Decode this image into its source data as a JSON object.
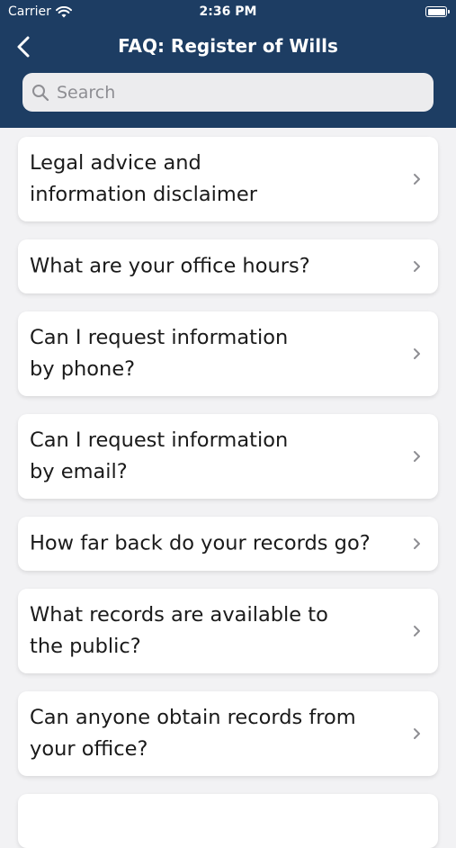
{
  "status_bar": {
    "carrier": "Carrier",
    "time": "2:36 PM"
  },
  "nav": {
    "title": "FAQ: Register of Wills",
    "back_icon": "chevron-left-icon"
  },
  "search": {
    "placeholder": "Search",
    "value": ""
  },
  "faq_items": [
    {
      "label": "Legal advice and\ninformation disclaimer"
    },
    {
      "label": "What are your office hours?"
    },
    {
      "label": "Can I request information\nby phone?"
    },
    {
      "label": "Can I request information\nby email?"
    },
    {
      "label": "How far back do your records go?"
    },
    {
      "label": "What records are available to\nthe public?"
    },
    {
      "label": "Can anyone obtain records from\nyour office?"
    },
    {
      "label": ""
    }
  ],
  "colors": {
    "header": "#1d3d63",
    "background": "#f2f2f4",
    "card": "#ffffff",
    "chevron": "#8e8e93"
  }
}
